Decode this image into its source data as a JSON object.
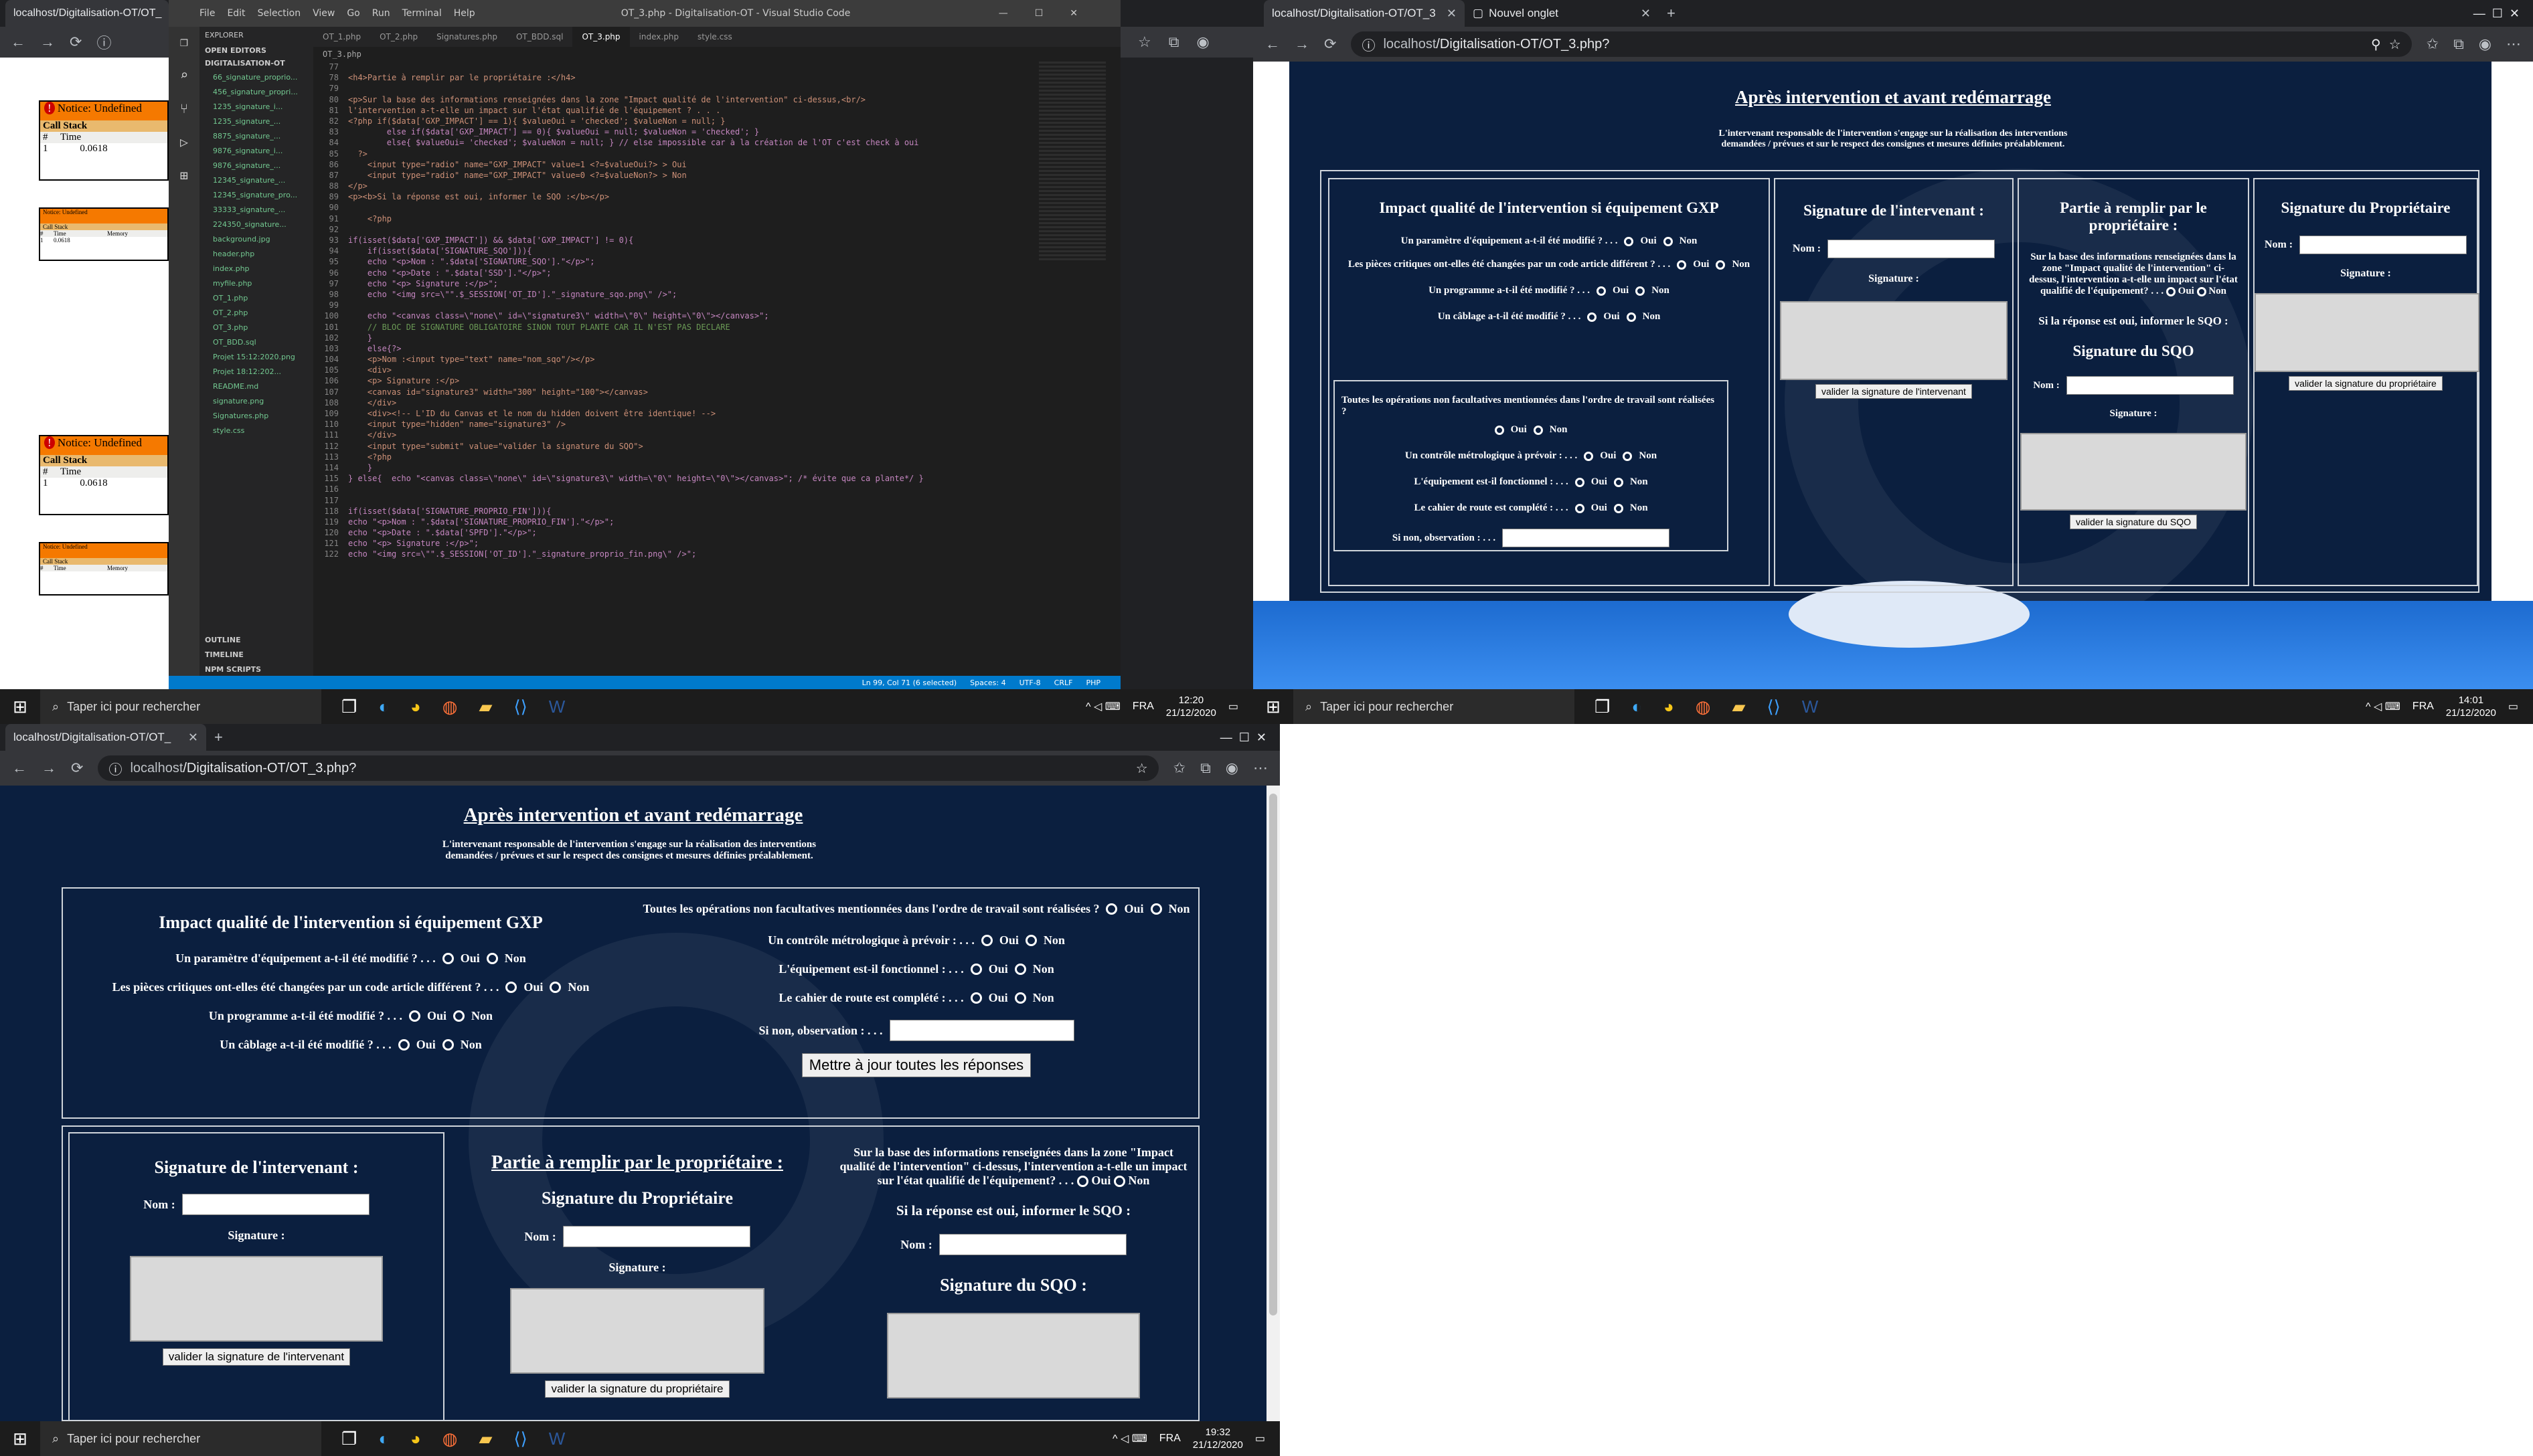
{
  "q1": {
    "window_title": "OT_3.php - Digitalisation-OT - Visual Studio Code",
    "browser_tab": "localhost/Digitalisation-OT/OT_",
    "menu": [
      "File",
      "Edit",
      "Selection",
      "View",
      "Go",
      "Run",
      "Terminal",
      "Help"
    ],
    "editor_tabs": [
      "OT_1.php",
      "OT_2.php",
      "Signatures.php",
      "OT_BDD.sql",
      "OT_3.php",
      "index.php",
      "style.css"
    ],
    "explorer": {
      "title": "EXPLORER",
      "open_editors": "OPEN EDITORS",
      "project": "DIGITALISATION-OT",
      "files": [
        "66_signature_proprio...",
        "456_signature_propri...",
        "1235_signature_i...",
        "1235_signature_...",
        "8875_signature_...",
        "9876_signature_i...",
        "9876_signature_...",
        "12345_signature_...",
        "12345_signature_pro...",
        "33333_signature_...",
        "224350_signature...",
        "background.jpg",
        "header.php",
        "index.php",
        "myfile.php",
        "OT_1.php",
        "OT_2.php",
        "OT_3.php",
        "OT_BDD.sql",
        "Projet 15:12:2020.png",
        "Projet 18:12:202...",
        "README.md",
        "signature.png",
        "Signatures.php",
        "style.css"
      ],
      "outline": "OUTLINE",
      "timeline": "TIMELINE",
      "npm": "NPM SCRIPTS"
    },
    "breadcrumb": "OT_3.php",
    "code_start": 77,
    "code": [
      "",
      "<h4>Partie à remplir par le propriétaire :</h4>",
      "",
      "<p>Sur la base des informations renseignées dans la zone \"Impact qualité de l'intervention\" ci-dessus,<br/>",
      "l'intervention a-t-elle un impact sur l'état qualifié de l'équipement ? . . .",
      "<?php if($data['GXP_IMPACT'] == 1){ $valueOui = 'checked'; $valueNon = null; }",
      "        else if($data['GXP_IMPACT'] == 0){ $valueOui = null; $valueNon = 'checked'; }",
      "        else{ $valueOui= 'checked'; $valueNon = null; } // else impossible car à la création de l'OT c'est check à oui",
      "  ?>",
      "    <input type=\"radio\" name=\"GXP_IMPACT\" value=1 <?=$valueOui?> > Oui",
      "    <input type=\"radio\" name=\"GXP_IMPACT\" value=0 <?=$valueNon?> > Non",
      "</p>",
      "<p><b>Si la réponse est oui, informer le SQO :</b></p>",
      "",
      "    <?php",
      "",
      "if(isset($data['GXP_IMPACT']) && $data['GXP_IMPACT'] != 0){",
      "    if(isset($data['SIGNATURE_SQO'])){",
      "    echo \"<p>Nom : \".$data['SIGNATURE_SQO'].\"</p>\";",
      "    echo \"<p>Date : \".$data['SSD'].\"</p>\";",
      "    echo \"<p> Signature :</p>\";",
      "    echo \"<img src=\\\"\".$_SESSION['OT_ID'].\"_signature_sqo.png\\\" />\";",
      "",
      "    echo \"<canvas class=\\\"none\\\" id=\\\"signature3\\\" width=\\\"0\\\" height=\\\"0\\\"></canvas>\";",
      "    // BLOC DE SIGNATURE OBLIGATOIRE SINON TOUT PLANTE CAR IL N'EST PAS DECLARE",
      "    }",
      "    else{?>",
      "    <p>Nom :<input type=\"text\" name=\"nom_sqo\"/></p>",
      "    <div>",
      "    <p> Signature :</p>",
      "    <canvas id=\"signature3\" width=\"300\" height=\"100\"></canvas>",
      "    </div>",
      "    <div><!-- L'ID du Canvas et le nom du hidden doivent être identique! -->",
      "    <input type=\"hidden\" name=\"signature3\" />",
      "    </div>",
      "    <input type=\"submit\" value=\"valider la signature du SQO\">",
      "    <?php",
      "    }",
      "} else{  echo \"<canvas class=\\\"none\\\" id=\\\"signature3\\\" width=\\\"0\\\" height=\\\"0\\\"></canvas>\"; /* évite que ca plante*/ }",
      "",
      "",
      "if(isset($data['SIGNATURE_PROPRIO_FIN'])){",
      "echo \"<p>Nom : \".$data['SIGNATURE_PROPRIO_FIN'].\"</p>\";",
      "echo \"<p>Date : \".$data['SPFD'].\"</p>\";",
      "echo \"<p> Signature :</p>\";",
      "echo \"<img src=\\\"\".$_SESSION['OT_ID'].\"_signature_proprio_fin.png\\\" />\";"
    ],
    "status": [
      "Ln 99, Col 71 (6 selected)",
      "Spaces: 4",
      "UTF-8",
      "CRLF",
      "PHP"
    ],
    "notice": {
      "title": "Notice: Undefined",
      "call": "Call Stack",
      "hash": "#",
      "time": "Time",
      "memory": "Memory",
      "n": "1",
      "val": "0.0618"
    },
    "taskbar": {
      "search": "Taper ici pour rechercher",
      "time": "12:20",
      "date": "21/12/2020",
      "lang": "FRA"
    }
  },
  "q2": {
    "tab1": "localhost/Digitalisation-OT/OT_3",
    "tab2": "Nouvel onglet",
    "url_domain": "localhost",
    "url_path": "/Digitalisation-OT/OT_3.php?",
    "title": "Après intervention et avant redémarrage",
    "intro": "L'intervenant responsable de l'intervention s'engage sur la réalisation des interventions demandées / prévues et sur le respect des consignes et mesures définies préalablement.",
    "impact_title": "Impact qualité de l'intervention si équipement GXP",
    "q_param": "Un paramètre d'équipement a-t-il été modifié ? . . .",
    "q_pieces": "Les pièces critiques ont-elles été changées par un code article différent ? . . .",
    "q_prog": "Un programme a-t-il été modifié ? . . .",
    "q_cablage": "Un câblage a-t-il été modifié ? . . .",
    "q_ops": "Toutes les opérations non facultatives mentionnées dans l'ordre de travail sont réalisées ?",
    "q_metro": "Un contrôle métrologique à prévoir : . . .",
    "q_fonct": "L'équipement est-il fonctionnel : . . .",
    "q_cahier": "Le cahier de route est complété : . . .",
    "q_obs": "Si non, observation : . . .",
    "oui": "Oui",
    "non": "Non",
    "sig_interv_title": "Signature de l'intervenant :",
    "nom": "Nom :",
    "signature": "Signature :",
    "btn_interv": "valider la signature de l'intervenant",
    "proprio_part": "Partie à remplir par le propriétaire :",
    "proprio_text": "Sur la base des informations renseignées dans la zone \"Impact qualité de l'intervention\" ci-dessus, l'intervention a-t-elle un impact sur l'état qualifié de l'équipement? . . .",
    "sqo_info": "Si la réponse est oui, informer le SQO :",
    "sqo_title": "Signature du SQO",
    "btn_sqo": "valider la signature du SQO",
    "proprio_title": "Signature du Propriétaire",
    "btn_proprio": "valider la signature du propriétaire",
    "taskbar": {
      "search": "Taper ici pour rechercher",
      "time": "14:01",
      "date": "21/12/2020",
      "lang": "FRA"
    }
  },
  "q3": {
    "tab1": "localhost/Digitalisation-OT/OT_",
    "url_domain": "localhost",
    "url_path": "/Digitalisation-OT/OT_3.php?",
    "sqo_title": "Signature du SQO :",
    "sqo_info": "Si la réponse est oui, informer le SQO :",
    "update_btn": "Mettre à jour toutes les réponses",
    "proprio_part": "Partie à remplir par le propriétaire :",
    "taskbar": {
      "search": "Taper ici pour rechercher",
      "time": "19:32",
      "date": "21/12/2020",
      "lang": "FRA"
    }
  }
}
